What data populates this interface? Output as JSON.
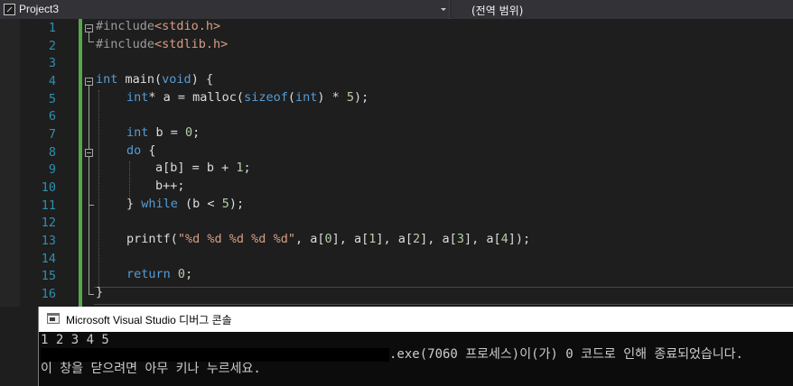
{
  "navbar": {
    "project": "Project3",
    "scope": "(전역 범위)"
  },
  "editor": {
    "line_numbers": [
      "1",
      "2",
      "3",
      "4",
      "5",
      "6",
      "7",
      "8",
      "9",
      "10",
      "11",
      "12",
      "13",
      "14",
      "15",
      "16"
    ]
  },
  "colors": {
    "keyword": "#569cd6",
    "string": "#d69d85",
    "number": "#b5cea8",
    "preprocessor": "#9b9b9b",
    "line_number": "#2b91af",
    "change_bar": "#57a64a"
  },
  "code": {
    "l1_pp": "#include",
    "l1_hdr": "<stdio.h>",
    "l2_pp": "#include",
    "l2_hdr": "<stdlib.h>",
    "l4_kw": "int",
    "l4_rest": " main(",
    "l4_kw2": "void",
    "l4_end": ") {",
    "l5_kw": "int",
    "l5_mid": "* a = malloc(",
    "l5_kw2": "sizeof",
    "l5_p": "(",
    "l5_kw3": "int",
    "l5_mul": ") * ",
    "l5_num": "5",
    "l5_end": ");",
    "l7_kw": "int",
    "l7_mid": " b = ",
    "l7_num": "0",
    "l7_end": ";",
    "l8_kw": "do",
    "l8_end": " {",
    "l9_a": "a[b] = b + ",
    "l9_num": "1",
    "l9_end": ";",
    "l10": "b++;",
    "l11_a": "} ",
    "l11_kw": "while",
    "l11_b": " (b < ",
    "l11_num": "5",
    "l11_end": ");",
    "l13_a": "printf(",
    "l13_str": "\"%d %d %d %d %d\"",
    "l13_b": ", a[",
    "l13_n0": "0",
    "l13_c": "], a[",
    "l13_n1": "1",
    "l13_d": "], a[",
    "l13_n2": "2",
    "l13_e": "], a[",
    "l13_n3": "3",
    "l13_f": "], a[",
    "l13_n4": "4",
    "l13_end": "]);",
    "l15_kw": "return",
    "l15_sp": " ",
    "l15_num": "0",
    "l15_end": ";",
    "l16": "}"
  },
  "console": {
    "title": "Microsoft Visual Studio 디버그 콘솔",
    "output": "1 2 3 4 5",
    "exit_msg": ".exe(7060 프로세스)이(가) 0 코드로 인해 종료되었습니다.",
    "prompt": "이 창을 닫으려면 아무 키나 누르세요."
  }
}
